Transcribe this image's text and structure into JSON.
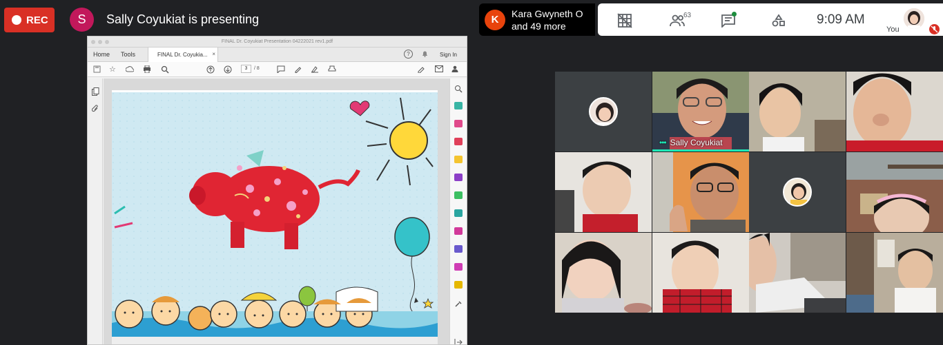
{
  "meeting": {
    "rec_label": "REC",
    "presenter_initial": "S",
    "presenter_text": "Sally Coyukiat is presenting",
    "others": {
      "initial": "K",
      "name": "Kara Gwyneth O",
      "more": "and 49 more"
    },
    "participant_count": "63",
    "time": "9:09  AM",
    "you_label": "You"
  },
  "pdf": {
    "window_title": "FINAL Dr. Coyukiat Presentation 04222021 rev1.pdf",
    "tabs": {
      "home": "Home",
      "tools": "Tools",
      "doc": "FINAL Dr. Coyukia...",
      "close": "×"
    },
    "help": "?",
    "sign_in": "Sign In",
    "page_current": "3",
    "page_total": "/ 8"
  },
  "gallery": {
    "speaker_name": "Sally Coyukiat"
  },
  "colors": {
    "rec": "#d93025",
    "presenter_avatar": "#c2185b",
    "others_avatar": "#e8430c",
    "speaking_accent": "#1de9b6",
    "chat_indicator": "#1e8e3e"
  },
  "icons": [
    "grid-off-icon",
    "people-icon",
    "chat-icon",
    "activities-icon",
    "mic-off-icon"
  ]
}
